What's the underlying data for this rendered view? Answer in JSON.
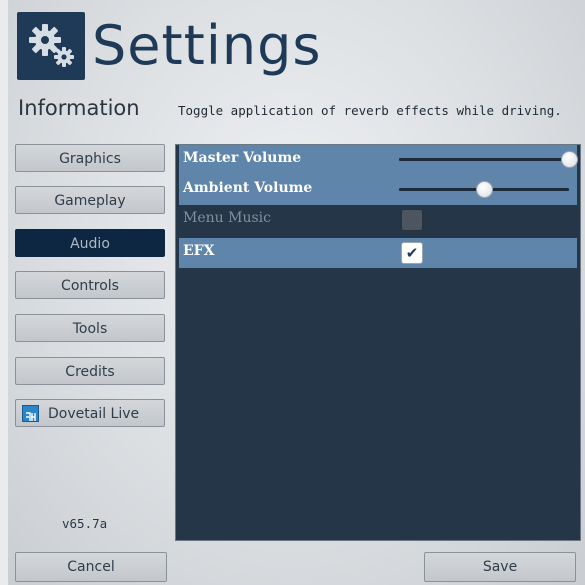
{
  "header": {
    "title": "Settings",
    "icon": "gears-icon"
  },
  "info": {
    "label": "Information",
    "text": "Toggle application of reverb effects while driving."
  },
  "sidebar": {
    "items": [
      {
        "label": "Graphics",
        "active": false
      },
      {
        "label": "Gameplay",
        "active": false
      },
      {
        "label": "Audio",
        "active": true
      },
      {
        "label": "Controls",
        "active": false
      },
      {
        "label": "Tools",
        "active": false
      },
      {
        "label": "Credits",
        "active": false
      },
      {
        "label": "Dovetail Live",
        "active": false,
        "icon": "dovetail-live-icon"
      }
    ]
  },
  "version": "v65.7a",
  "audio": {
    "master_volume": {
      "label": "Master Volume",
      "value": 1.0
    },
    "ambient_volume": {
      "label": "Ambient Volume",
      "value": 0.5
    },
    "menu_music": {
      "label": "Menu Music",
      "checked": false,
      "enabled": false
    },
    "efx": {
      "label": "EFX",
      "checked": true,
      "enabled": true
    }
  },
  "footer": {
    "cancel_label": "Cancel",
    "save_label": "Save"
  },
  "colors": {
    "accent_dark": "#1f3a56",
    "row_highlight": "#5f86aa",
    "panel_bg": "#243648",
    "active_tab": "#0d2742"
  }
}
